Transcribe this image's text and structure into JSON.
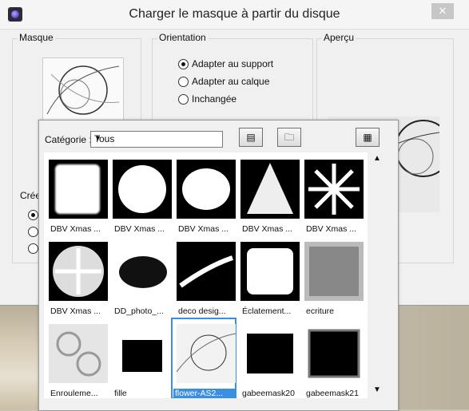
{
  "window": {
    "title": "Charger le masque à partir du disque",
    "close": "✕"
  },
  "masque": {
    "label": "Masque"
  },
  "orientation": {
    "label": "Orientation",
    "options": [
      {
        "label": "Adapter au support",
        "selected": true
      },
      {
        "label": "Adapter au calque",
        "selected": false
      },
      {
        "label": "Inchangée",
        "selected": false
      }
    ]
  },
  "apercu": {
    "label": "Aperçu"
  },
  "creer": {
    "label": "Créer"
  },
  "popup": {
    "category_label": "Catégorie :",
    "category_value": "Tous",
    "items": [
      {
        "label": "DBV Xmas ...",
        "icon": "frame-rect"
      },
      {
        "label": "DBV Xmas ...",
        "icon": "frame-round"
      },
      {
        "label": "DBV Xmas ...",
        "icon": "blob"
      },
      {
        "label": "DBV Xmas ...",
        "icon": "tree"
      },
      {
        "label": "DBV Xmas ...",
        "icon": "snowflake"
      },
      {
        "label": "DBV Xmas ...",
        "icon": "snowflake-round"
      },
      {
        "label": "DD_photo_...",
        "icon": "splash"
      },
      {
        "label": "deco desig...",
        "icon": "deco"
      },
      {
        "label": "Éclatement...",
        "icon": "burst"
      },
      {
        "label": "ecriture",
        "icon": "texture"
      },
      {
        "label": "Enrouleme...",
        "icon": "swirls"
      },
      {
        "label": "fille",
        "icon": "fille"
      },
      {
        "label": "flower-AS2...",
        "icon": "flower",
        "selected": true
      },
      {
        "label": "gabeemask20",
        "icon": "frame-dark"
      },
      {
        "label": "gabeemask21",
        "icon": "frame-ornate"
      }
    ]
  },
  "colors": {
    "selection": "#3b8fe0"
  }
}
